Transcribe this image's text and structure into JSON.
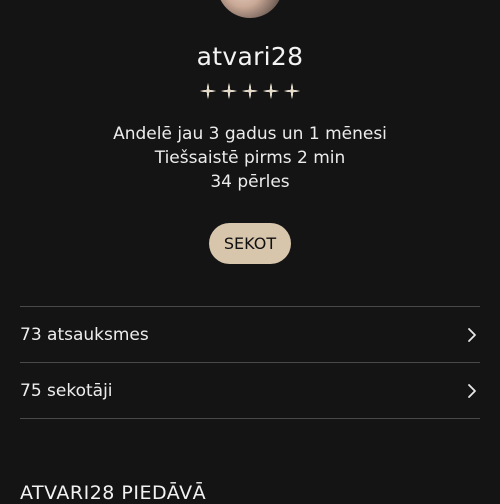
{
  "profile": {
    "username": "atvari28",
    "rating_stars": 5,
    "rating_color": "#e6dccb",
    "info_lines": [
      "Andelē jau 3 gadus un 1 mēnesi",
      "Tiešsaistē pirms 2 min",
      "34 pērles"
    ],
    "follow_label": "SEKOT"
  },
  "links": [
    {
      "label": "73 atsauksmes",
      "icon": "chevron-right-icon"
    },
    {
      "label": "75 sekotāji",
      "icon": "chevron-right-icon"
    }
  ],
  "section": {
    "title": "ATVARI28 PIEDĀVĀ"
  },
  "colors": {
    "background": "#141414",
    "accent_button": "#d7c5ac",
    "divider": "#4a4a4a"
  }
}
